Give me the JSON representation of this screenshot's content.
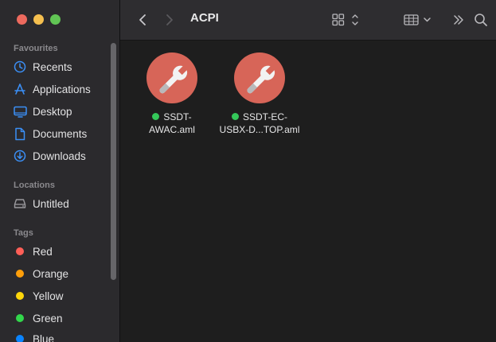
{
  "window": {
    "title": "ACPI"
  },
  "sidebar": {
    "favourites_title": "Favourites",
    "favourites": [
      {
        "label": "Recents",
        "icon": "clock-icon"
      },
      {
        "label": "Applications",
        "icon": "applications-icon"
      },
      {
        "label": "Desktop",
        "icon": "desktop-icon"
      },
      {
        "label": "Documents",
        "icon": "document-icon"
      },
      {
        "label": "Downloads",
        "icon": "download-icon"
      }
    ],
    "locations_title": "Locations",
    "locations": [
      {
        "label": "Untitled",
        "icon": "disk-icon"
      }
    ],
    "tags_title": "Tags",
    "tags": [
      {
        "label": "Red",
        "color": "#ff5f57"
      },
      {
        "label": "Orange",
        "color": "#ff9f0a"
      },
      {
        "label": "Yellow",
        "color": "#ffd60a"
      },
      {
        "label": "Green",
        "color": "#32d74b"
      },
      {
        "label": "Blue",
        "color": "#0a84ff"
      }
    ],
    "accent_color": "#3b8ff6"
  },
  "files": [
    {
      "line1": "SSDT-",
      "line2": "AWAC.aml",
      "status_color": "#34c759"
    },
    {
      "line1": "SSDT-EC-",
      "line2": "USBX-D...TOP.aml",
      "status_color": "#34c759"
    }
  ]
}
